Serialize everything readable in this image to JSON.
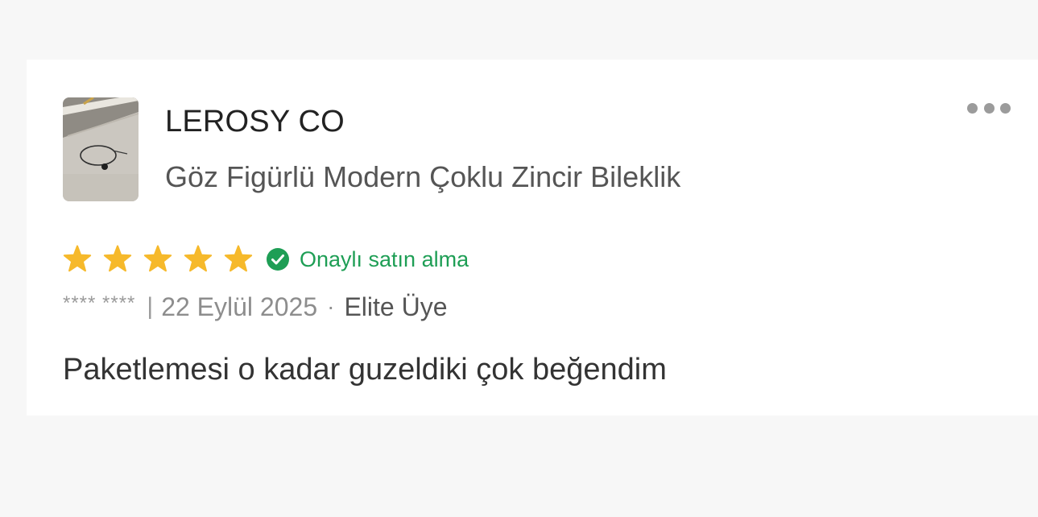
{
  "review": {
    "seller_name": "LEROSY CO",
    "product_name": "Göz Figürlü Modern Çoklu Zincir Bileklik",
    "rating": 5,
    "rating_max": 5,
    "verified_label": "Onaylı satın alma",
    "reviewer_name": "**** ****",
    "meta_separator": "|",
    "date": "22 Eylül 2025",
    "dot_separator": "·",
    "member_level": "Elite Üye",
    "text": "Paketlemesi o kadar guzeldiki çok beğendim"
  },
  "icons": {
    "more": "more-horizontal-icon",
    "star": "star-icon",
    "verified": "check-circle-icon"
  },
  "colors": {
    "page_background": "#f7f7f7",
    "card_background": "#ffffff",
    "star": "#f6b92b",
    "verified": "#1e9e55",
    "muted_text": "#8d8d8d"
  }
}
